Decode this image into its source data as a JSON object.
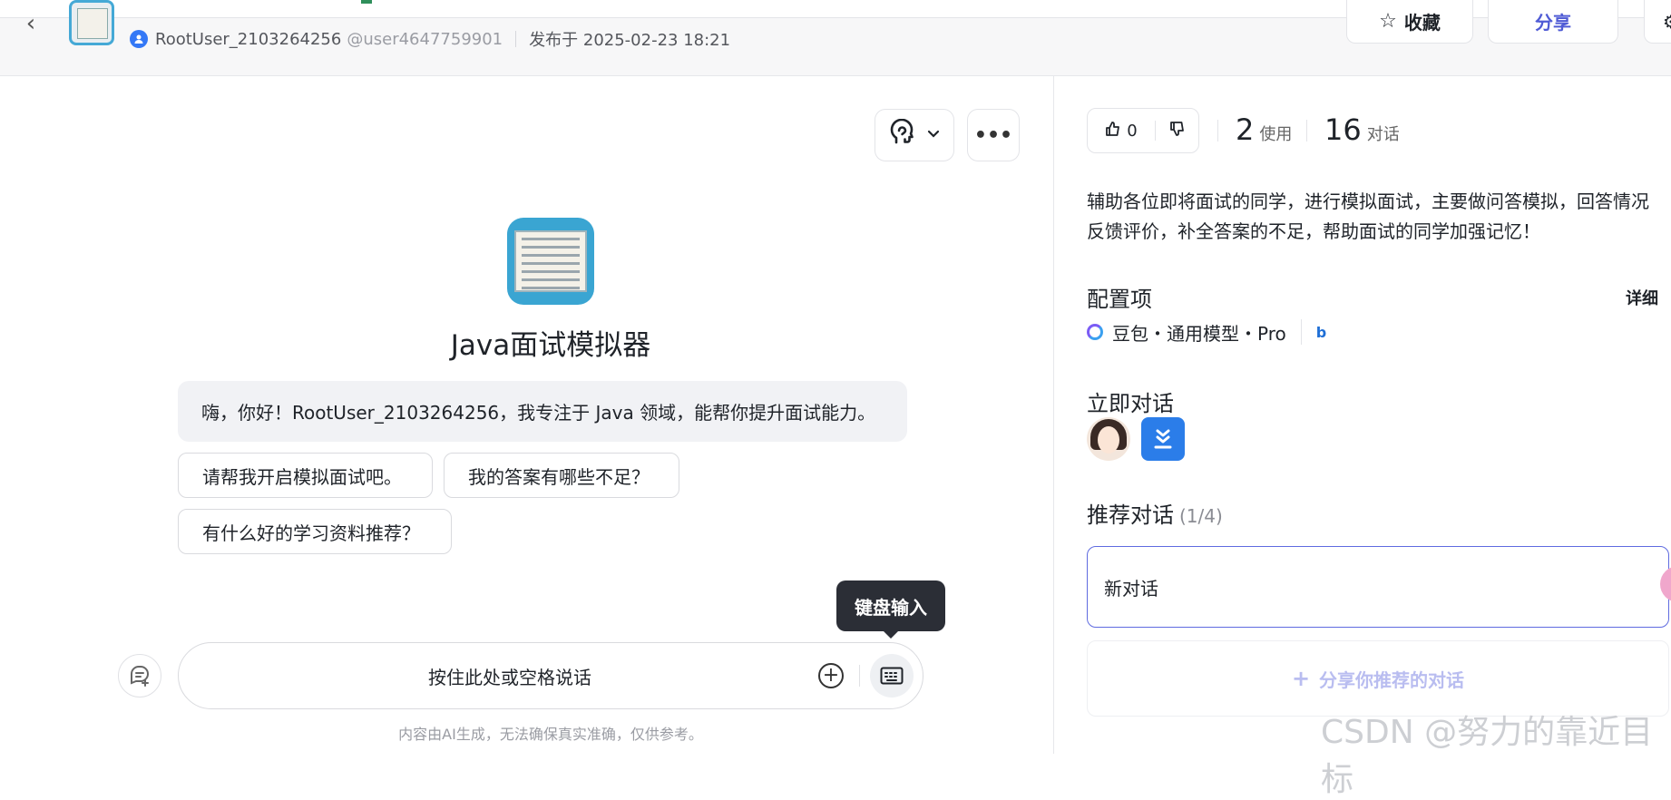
{
  "header": {
    "author_name": "RootUser_2103264256",
    "author_handle": "@user4647759901",
    "publish_text": "发布于 2025-02-23 18:21",
    "favorite_label": "收藏",
    "share_label": "分享"
  },
  "chat": {
    "bot_title": "Java面试模拟器",
    "greeting": "嗨，你好！RootUser_2103264256，我专注于 Java 领域，能帮你提升面试能力。",
    "suggestions": [
      "请帮我开启模拟面试吧。",
      "我的答案有哪些不足？",
      "有什么好的学习资料推荐？"
    ],
    "tooltip": "键盘输入",
    "voice_hint": "按住此处或空格说话",
    "disclaimer": "内容由AI生成，无法确保真实准确，仅供参考。"
  },
  "side": {
    "like_count": "0",
    "use_count": "2",
    "use_label": "使用",
    "chat_count": "16",
    "chat_label": "对话",
    "description": "辅助各位即将面试的同学，进行模拟面试，主要做问答模拟，回答情况反馈评价，补全答案的不足，帮助面试的同学加强记忆！",
    "config_title": "配置项",
    "detail_label": "详细",
    "model_text": "豆包・通用模型・Pro",
    "bing_glyph": "b",
    "chat_now_title": "立即对话",
    "recommend_title": "推荐对话",
    "recommend_count": "(1/4)",
    "recommend_item": "新对话",
    "share_recommend_label": "分享你推荐的对话"
  },
  "watermark": "CSDN @努力的靠近目标",
  "colors": {
    "accent": "#5f6be0",
    "share_text": "#4f5bd5",
    "tooltip_bg": "#2b2e36",
    "app_blue": "#2b7de9"
  }
}
